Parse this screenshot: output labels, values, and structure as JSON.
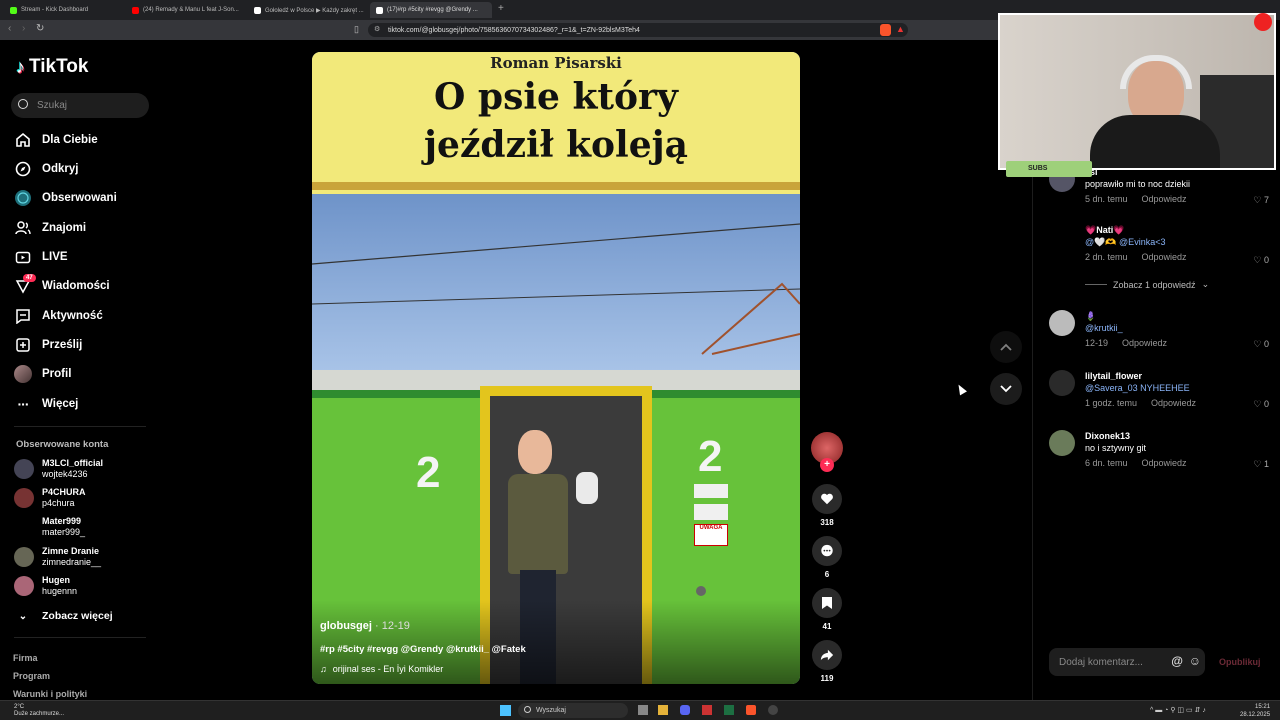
{
  "browser": {
    "tabs": [
      {
        "label": "Stream - Kick Dashboard",
        "icon_color": "#53fc18"
      },
      {
        "label": "(24) Remady & Manu L feat J-Son...",
        "icon_color": "#ff0000"
      },
      {
        "label": "Gołoledź w Polsce ▶ Każdy zakręt ...",
        "icon_color": "#ffffff"
      },
      {
        "label": "(17)#rp #5city #revgg @Grendy ...",
        "icon_color": "#ffffff"
      }
    ],
    "url": "tiktok.com/@globusgej/photo/7585636070734302486?_r=1&_t=ZN-92blsM3Teh4"
  },
  "sidebar": {
    "logo": "TikTok",
    "search_placeholder": "Szukaj",
    "nav": [
      {
        "label": "Dla Ciebie",
        "icon": "home-icon"
      },
      {
        "label": "Odkryj",
        "icon": "compass-icon"
      },
      {
        "label": "Obserwowani",
        "icon": "following-icon"
      },
      {
        "label": "Znajomi",
        "icon": "friends-icon"
      },
      {
        "label": "LIVE",
        "icon": "live-icon"
      },
      {
        "label": "Wiadomości",
        "icon": "messages-icon",
        "badge": "47"
      },
      {
        "label": "Aktywność",
        "icon": "activity-icon"
      },
      {
        "label": "Prześlij",
        "icon": "upload-icon"
      },
      {
        "label": "Profil",
        "icon": "profile-icon"
      },
      {
        "label": "Więcej",
        "icon": "more-icon"
      }
    ],
    "followed_title": "Obserwowane konta",
    "accounts": [
      {
        "name": "M3LCI_official",
        "handle": "wojtek4236"
      },
      {
        "name": "P4CHURA",
        "handle": "p4chura"
      },
      {
        "name": "Mater999",
        "handle": "mater999_"
      },
      {
        "name": "Zimne Dranie",
        "handle": "zimnedranie__"
      },
      {
        "name": "Hugen",
        "handle": "hugennn"
      }
    ],
    "see_more": "Zobacz więcej",
    "footer": [
      "Firma",
      "Program",
      "Warunki i polityki"
    ]
  },
  "video": {
    "book_author": "Roman Pisarski",
    "book_title_line1": "O psie który",
    "book_title_line2": "jeździł koleją",
    "train_number": "2",
    "warning_label": "UWAGA",
    "author": "globusgej",
    "date": "12-19",
    "caption": "#rp #5city #revgg @Grendy @krutkii_ @Fatek",
    "sound": "orijinal ses - En İyi Komikler"
  },
  "actions": {
    "likes": "318",
    "comments": "6",
    "saves": "41",
    "shares": "119"
  },
  "comments": {
    "list": [
      {
        "name": "ssi",
        "text": "poprawiło mi to noc dziekii",
        "time": "5 dn. temu",
        "reply": "Odpowiedz",
        "likes": "7"
      },
      {
        "name": "💗Nati💗",
        "text": "@🤍🫶 @Evinka<3",
        "time": "2 dn. temu",
        "reply": "Odpowiedz",
        "likes": "0"
      },
      {
        "name": "🪻",
        "text": "@krutkii_",
        "time": "12-19",
        "reply": "Odpowiedz",
        "likes": "0"
      },
      {
        "name": "lilytail_flower",
        "text": "@Savera_03 NYHEEHEE",
        "time": "1 godz. temu",
        "reply": "Odpowiedz",
        "likes": "0"
      },
      {
        "name": "Dixonek13",
        "text": "no i sztywny git",
        "time": "6 dn. temu",
        "reply": "Odpowiedz",
        "likes": "1"
      }
    ],
    "view_replies": "Zobacz 1 odpowiedź",
    "input_placeholder": "Dodaj komentarz...",
    "publish": "Opublikuj"
  },
  "webcam": {
    "subs_label": "SUBS"
  },
  "taskbar": {
    "weather_temp": "2°C",
    "weather_text": "Duże zachmurze...",
    "search": "Wyszukaj",
    "time": "15:21",
    "date": "28.12.2025"
  }
}
